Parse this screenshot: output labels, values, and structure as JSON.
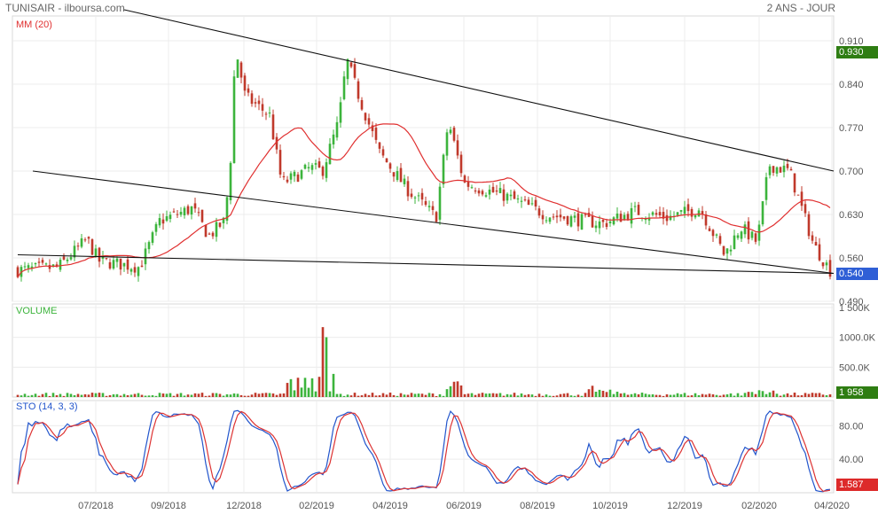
{
  "header": {
    "title": "TUNISAIR - ilboursa.com",
    "period": "2 ANS - JOUR"
  },
  "colors": {
    "up": "#3cb43c",
    "down": "#c0392b",
    "ma": "#e03030",
    "sto_k": "#2255cc",
    "sto_d": "#dd3333",
    "last_price_tag": "#2e7d12",
    "low_tag": "#2f5fd6",
    "vol_tag": "#2e7d12",
    "sto_tag": "#dd2a2a"
  },
  "panels": {
    "price": {
      "indicator_label": "MM (20)",
      "y_ticks": [
        "0.910",
        "0.840",
        "0.770",
        "0.700",
        "0.630",
        "0.560",
        "0.490"
      ],
      "last_price_tag": "0.930",
      "level_tag": "0.540"
    },
    "volume": {
      "label": "VOLUME",
      "y_ticks": [
        "1 500K",
        "1000.0K",
        "500.0K"
      ],
      "last_value_tag": "1 958"
    },
    "stochastic": {
      "label": "STO (14, 3, 3)",
      "y_ticks": [
        "80.00",
        "40.00"
      ],
      "last_value_tag": "1.587"
    }
  },
  "x_axis_labels": [
    "07/2018",
    "09/2018",
    "12/2018",
    "02/2019",
    "04/2019",
    "06/2019",
    "08/2019",
    "10/2019",
    "12/2019",
    "02/2020",
    "04/2020"
  ],
  "chart_data": {
    "type": "candlestick",
    "price_range": [
      0.49,
      0.95
    ],
    "price_path": [
      {
        "t": 0,
        "p": 0.54
      },
      {
        "t": 0.05,
        "p": 0.545
      },
      {
        "t": 0.085,
        "p": 0.59
      },
      {
        "t": 0.1,
        "p": 0.555
      },
      {
        "t": 0.15,
        "p": 0.545
      },
      {
        "t": 0.175,
        "p": 0.62
      },
      {
        "t": 0.215,
        "p": 0.64
      },
      {
        "t": 0.235,
        "p": 0.595
      },
      {
        "t": 0.255,
        "p": 0.62
      },
      {
        "t": 0.262,
        "p": 0.72
      },
      {
        "t": 0.268,
        "p": 0.9
      },
      {
        "t": 0.28,
        "p": 0.82
      },
      {
        "t": 0.31,
        "p": 0.79
      },
      {
        "t": 0.325,
        "p": 0.68
      },
      {
        "t": 0.34,
        "p": 0.69
      },
      {
        "t": 0.36,
        "p": 0.705
      },
      {
        "t": 0.375,
        "p": 0.7
      },
      {
        "t": 0.395,
        "p": 0.78
      },
      {
        "t": 0.405,
        "p": 0.88
      },
      {
        "t": 0.42,
        "p": 0.82
      },
      {
        "t": 0.445,
        "p": 0.73
      },
      {
        "t": 0.48,
        "p": 0.67
      },
      {
        "t": 0.515,
        "p": 0.625
      },
      {
        "t": 0.53,
        "p": 0.78
      },
      {
        "t": 0.55,
        "p": 0.68
      },
      {
        "t": 0.6,
        "p": 0.66
      },
      {
        "t": 0.65,
        "p": 0.63
      },
      {
        "t": 0.72,
        "p": 0.615
      },
      {
        "t": 0.76,
        "p": 0.635
      },
      {
        "t": 0.8,
        "p": 0.625
      },
      {
        "t": 0.84,
        "p": 0.64
      },
      {
        "t": 0.87,
        "p": 0.565
      },
      {
        "t": 0.89,
        "p": 0.61
      },
      {
        "t": 0.91,
        "p": 0.585
      },
      {
        "t": 0.925,
        "p": 0.71
      },
      {
        "t": 0.95,
        "p": 0.7
      },
      {
        "t": 0.965,
        "p": 0.64
      },
      {
        "t": 0.98,
        "p": 0.58
      },
      {
        "t": 1,
        "p": 0.54
      }
    ],
    "moving_average": {
      "name": "MM (20)",
      "period": 20
    },
    "trendlines": [
      {
        "from": {
          "date": "2018-08",
          "price": 0.96
        },
        "to": {
          "date": "2020-04",
          "price": 0.7
        }
      },
      {
        "from": {
          "date": "2018-06",
          "price": 0.7
        },
        "to": {
          "date": "2020-04",
          "price": 0.535
        }
      },
      {
        "from": {
          "date": "2018-05",
          "price": 0.565
        },
        "to": {
          "date": "2020-04",
          "price": 0.535
        }
      }
    ],
    "volume_range": [
      0,
      1500000
    ],
    "stochastic_range": [
      0,
      110
    ],
    "stochastic": {
      "k_period": 14,
      "smooth": 3,
      "d_period": 3
    }
  }
}
